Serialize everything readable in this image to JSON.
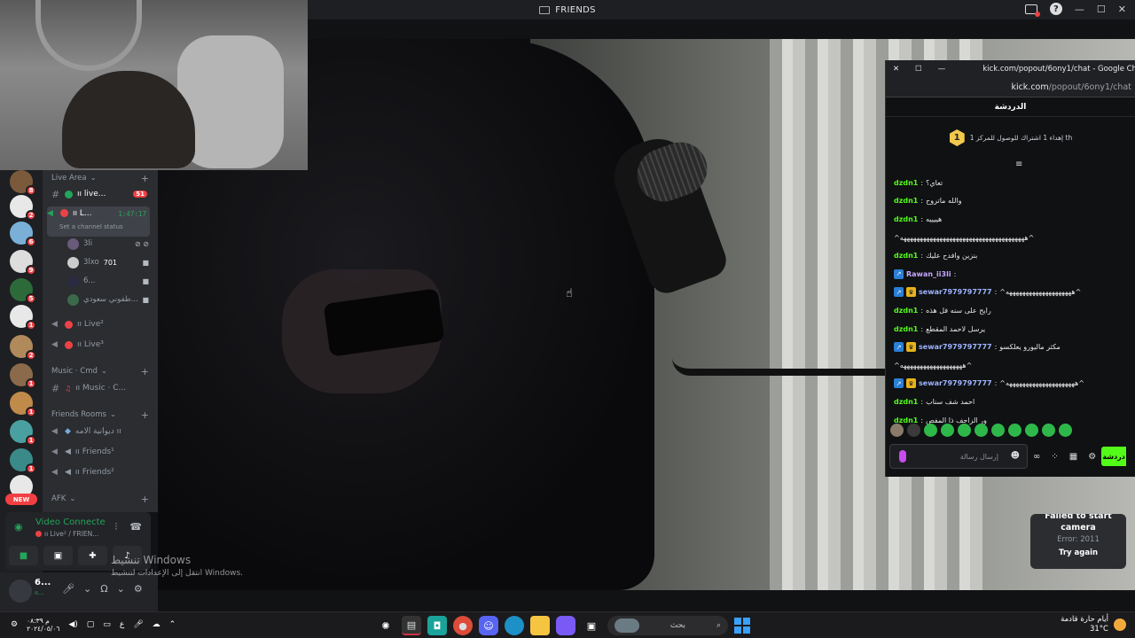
{
  "window": {
    "title": "FRIENDS",
    "minimize": "—",
    "maximize": "☐",
    "close": "✕"
  },
  "servers": [
    {
      "badge": "8"
    },
    {
      "badge": "2"
    },
    {
      "badge": "6"
    },
    {
      "badge": "9"
    },
    {
      "badge": "5"
    },
    {
      "badge": "1"
    },
    {
      "badge": "2"
    },
    {
      "badge": "1"
    },
    {
      "badge": "1"
    },
    {
      "badge": "1"
    },
    {
      "badge": "1"
    },
    {
      "badge": ""
    }
  ],
  "new_pill": "NEW",
  "channels": {
    "live_area": "Live Area",
    "live_text": "ıı live...",
    "live_text_count": "51",
    "active_voice": "ıı L...",
    "active_timer": "1:47:17",
    "set_status": "Set a channel status",
    "members": [
      {
        "name": "3li",
        "right": ""
      },
      {
        "name": "3lxo",
        "right": "701"
      },
      {
        "name": "6...",
        "right": ""
      },
      {
        "name": "طفوني سعودي...",
        "right": ""
      }
    ],
    "live2": "ıı Live²",
    "live3": "ıı Live³",
    "music_cat": "Music · Cmd",
    "music_chan": "ıı Music · C...",
    "friends_cat": "Friends Rooms",
    "friends_rooms": [
      "ديوانية الامه ıı",
      "ıı Friends¹",
      "ıı Friends²"
    ],
    "afk_cat": "AFK"
  },
  "voice": {
    "status": "Video Connecte",
    "sub": "ıı Live² / FRIEN..."
  },
  "user": {
    "name": "6...",
    "tag": "ıı..."
  },
  "watermark": {
    "title": "تنشيط Windows",
    "sub": "انتقل إلى الإعدادات لتنشيط Windows."
  },
  "kick": {
    "chrome_title": "kick.com/popout/6ony1/chat - Google Chrome",
    "url_host": "kick.com",
    "url_path": "/popout/6ony1/chat",
    "room": "الدردشة",
    "goal_num": "1",
    "goal_text": "إهداء 1 اشتراك للوصول للمركز 1 th",
    "messages": [
      {
        "user": "dzdn1",
        "color": "green",
        "text": "تعاي؟",
        "badges": []
      },
      {
        "user": "dzdn1",
        "color": "green",
        "text": "والله ماتروح",
        "badges": []
      },
      {
        "user": "dzdn1",
        "color": "green",
        "text": "هييييه",
        "badges": []
      },
      {
        "user": "",
        "color": "green",
        "text": "^ههههههههههههههههههههههههههههههههههههههه^",
        "badges": []
      },
      {
        "user": "dzdn1",
        "color": "green",
        "text": "بنزين وافدح عليك",
        "badges": []
      },
      {
        "user": "Rawan_ii3li",
        "color": "purple",
        "text": "",
        "badges": [
          "pin"
        ]
      },
      {
        "user": "sewar7979797777",
        "color": "blue",
        "text": "^ههههههههههههههههههههه^",
        "badges": [
          "pin",
          "crown"
        ]
      },
      {
        "user": "dzdn1",
        "color": "green",
        "text": "رايح على سنه فل هذه",
        "badges": []
      },
      {
        "user": "dzdn1",
        "color": "green",
        "text": "يرسل لاحمد المقطع",
        "badges": []
      },
      {
        "user": "sewar7979797777",
        "color": "blue",
        "text": "مكثر ماليورو يعلكسو",
        "badges": [
          "pin",
          "crown"
        ]
      },
      {
        "user": "",
        "color": "green",
        "text": "^هههههههههههههههههههه^",
        "badges": []
      },
      {
        "user": "sewar7979797777",
        "color": "blue",
        "text": "^هههههههههههههههههههههه^",
        "badges": [
          "pin",
          "crown"
        ]
      },
      {
        "user": "dzdn1",
        "color": "green",
        "text": "احمد شف سناب",
        "badges": []
      },
      {
        "user": "dzdn1",
        "color": "green",
        "text": "ور الزاحف ذا المفص",
        "badges": []
      }
    ],
    "input_placeholder": "إرسال رسالة",
    "send": "دردشة"
  },
  "camera_error": {
    "title": "Failed to start camera",
    "error": "Error: 2011",
    "retry": "Try again"
  },
  "taskbar": {
    "clock_time": "م ٠٨:٣٩",
    "clock_date": "٢٠٢٤/٠٥/٠٦",
    "lang": "ع",
    "search": "بحث",
    "weather_title": "أيام حارة قادمة",
    "weather_temp": "31°C"
  }
}
